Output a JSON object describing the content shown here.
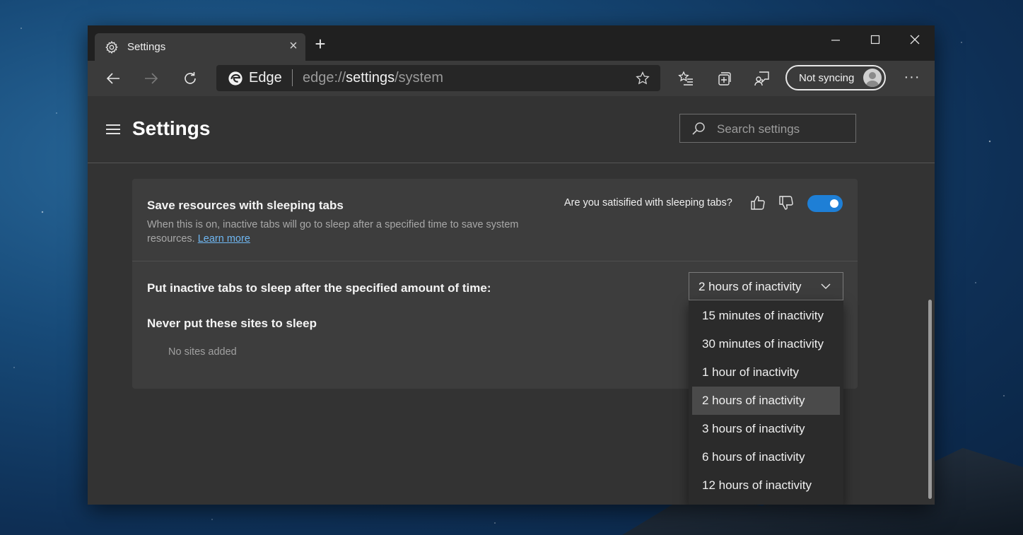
{
  "tab": {
    "title": "Settings"
  },
  "address": {
    "site": "Edge",
    "url_prefix": "edge://",
    "url_host": "settings",
    "url_path": "/system"
  },
  "profile": {
    "sync_label": "Not syncing"
  },
  "page": {
    "title": "Settings",
    "search_placeholder": "Search settings"
  },
  "sleeping": {
    "title": "Save resources with sleeping tabs",
    "description": "When this is on, inactive tabs will go to sleep after a specified time to save system resources.",
    "learn_more": "Learn more",
    "feedback_question": "Are you satisified with sleeping tabs?",
    "enabled": true
  },
  "timeout": {
    "label": "Put inactive tabs to sleep after the specified amount of time:",
    "selected": "2 hours of inactivity",
    "options": [
      "15 minutes of inactivity",
      "30 minutes of inactivity",
      "1 hour of inactivity",
      "2 hours of inactivity",
      "3 hours of inactivity",
      "6 hours of inactivity",
      "12 hours of inactivity"
    ],
    "selected_index": 3
  },
  "never_sleep": {
    "title": "Never put these sites to sleep",
    "empty_text": "No sites added"
  },
  "colors": {
    "accent": "#1e7fd6",
    "link": "#6fb7f2"
  }
}
